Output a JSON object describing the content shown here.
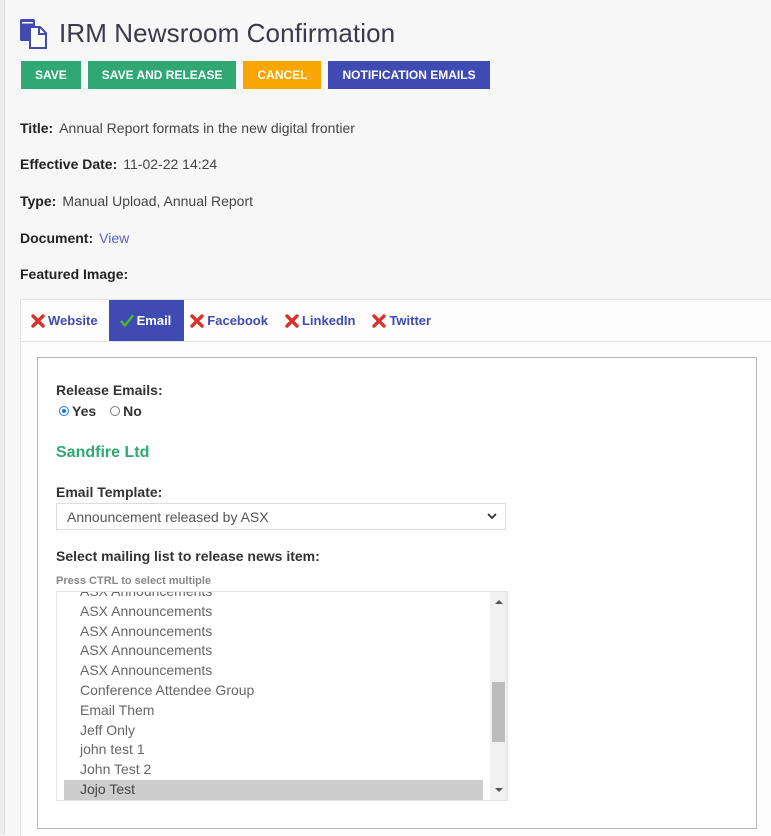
{
  "header": {
    "title": "IRM Newsroom Confirmation",
    "icon": "documents-icon"
  },
  "toolbar": {
    "save": "SAVE",
    "save_release": "SAVE AND RELEASE",
    "cancel": "CANCEL",
    "notification_emails": "NOTIFICATION EMAILS"
  },
  "colors": {
    "green": "#2fa873",
    "orange": "#f9a602",
    "blue": "#3f4bb3"
  },
  "details": {
    "title_label": "Title:",
    "title_value": "Annual Report formats in the new digital frontier",
    "date_label": "Effective Date:",
    "date_value": "11-02-22 14:24",
    "type_label": "Type:",
    "type_value": "Manual Upload, Annual Report",
    "document_label": "Document:",
    "document_link": "View",
    "featured_label": "Featured Image:"
  },
  "tabs": [
    {
      "label": "Website",
      "status": "x",
      "active": false
    },
    {
      "label": "Email",
      "status": "check",
      "active": true
    },
    {
      "label": "Facebook",
      "status": "x",
      "active": false
    },
    {
      "label": "LinkedIn",
      "status": "x",
      "active": false
    },
    {
      "label": "Twitter",
      "status": "x",
      "active": false
    }
  ],
  "email_panel": {
    "release_label": "Release Emails:",
    "yes_label": "Yes",
    "no_label": "No",
    "release_selected": "Yes",
    "company": "Sandfire Ltd",
    "template_label": "Email Template:",
    "template_value": "Announcement released by ASX",
    "mailing_label": "Select mailing list to release news item:",
    "mailing_hint": "Press CTRL to select multiple",
    "mailing_options": [
      "ASX Announcements",
      "ASX Announcements",
      "ASX Announcements",
      "ASX Announcements",
      "ASX Announcements",
      "Conference Attendee Group",
      "Email Them",
      "Jeff Only",
      "john test 1",
      "John Test 2",
      "Jojo Test"
    ],
    "selected_option": "Jojo Test"
  }
}
